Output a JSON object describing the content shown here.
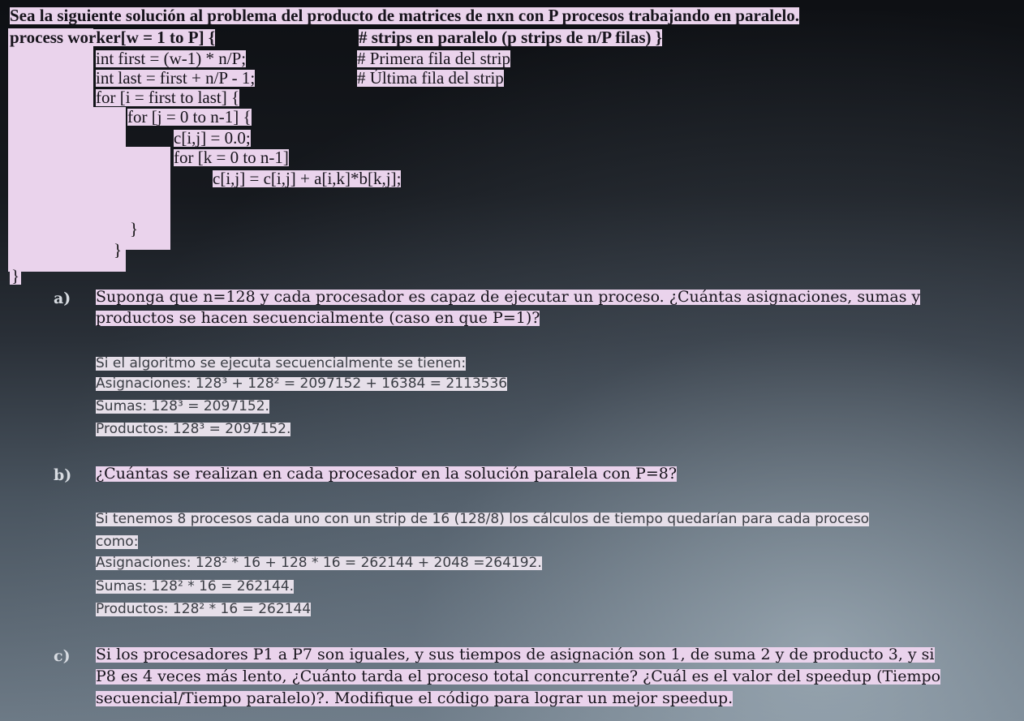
{
  "intro": {
    "heading": "Sea la siguiente solución al problema del producto de matrices de nxn con P procesos trabajando en paralelo.",
    "process_line": "process worker[w = 1 to P] {",
    "process_comment": "# strips en paralelo (p strips de n/P filas) }"
  },
  "code": {
    "first_line": "int first = (w-1) * n/P;",
    "first_comment": "# Primera fila del strip",
    "last_line": "int last = first + n/P - 1;",
    "last_comment": "# Última fila del strip",
    "for_i": "for [i = first to last] {",
    "for_j": "for [j = 0 to n-1] {",
    "init": "c[i,j] = 0.0;",
    "for_k": "for [k = 0 to n-1]",
    "accumulate": "c[i,j] = c[i,j] + a[i,k]*b[k,j];",
    "close_inner": "}",
    "close_outer": "}",
    "close_process": "}"
  },
  "questions": {
    "a": {
      "label": "a)",
      "line1": "Suponga que n=128 y cada procesador es capaz de ejecutar un proceso. ¿Cuántas asignaciones, sumas y",
      "line2": "productos se hacen secuencialmente (caso en que P=1)?",
      "answer_intro": "Si el algoritmo se ejecuta secuencialmente se tienen:",
      "asignaciones": "Asignaciones: 128³ + 128² = 2097152 + 16384 = 2113536",
      "sumas": "Sumas: 128³ = 2097152.",
      "productos": "Productos: 128³ = 2097152."
    },
    "b": {
      "label": "b)",
      "line1": "¿Cuántas se realizan en cada procesador en la solución paralela con P=8?",
      "answer_line1": "Si tenemos 8 procesos cada uno con un strip de 16 (128/8) los cálculos de tiempo quedarían para cada proceso",
      "answer_line2": "como:",
      "asignaciones": "Asignaciones: 128² * 16 + 128 * 16 = 262144 + 2048 =264192.",
      "sumas": "Sumas: 128² * 16  = 262144.",
      "productos": "Productos: 128² * 16 = 262144"
    },
    "c": {
      "label": "c)",
      "line1": "Si los procesadores P1 a P7 son iguales, y sus tiempos de asignación son 1, de suma 2 y de producto 3, y si",
      "line2": "P8 es 4 veces más lento, ¿Cuánto tarda el proceso total concurrente? ¿Cuál es el valor del speedup (Tiempo",
      "line3": "secuencial/Tiempo paralelo)?. Modifique el código para lograr un mejor speedup."
    }
  },
  "colors": {
    "highlight": "#ead3ec",
    "answer_highlight": "#e6dfe9",
    "answer_text": "#3a3d44",
    "spellcheck": "#c23b2f"
  }
}
